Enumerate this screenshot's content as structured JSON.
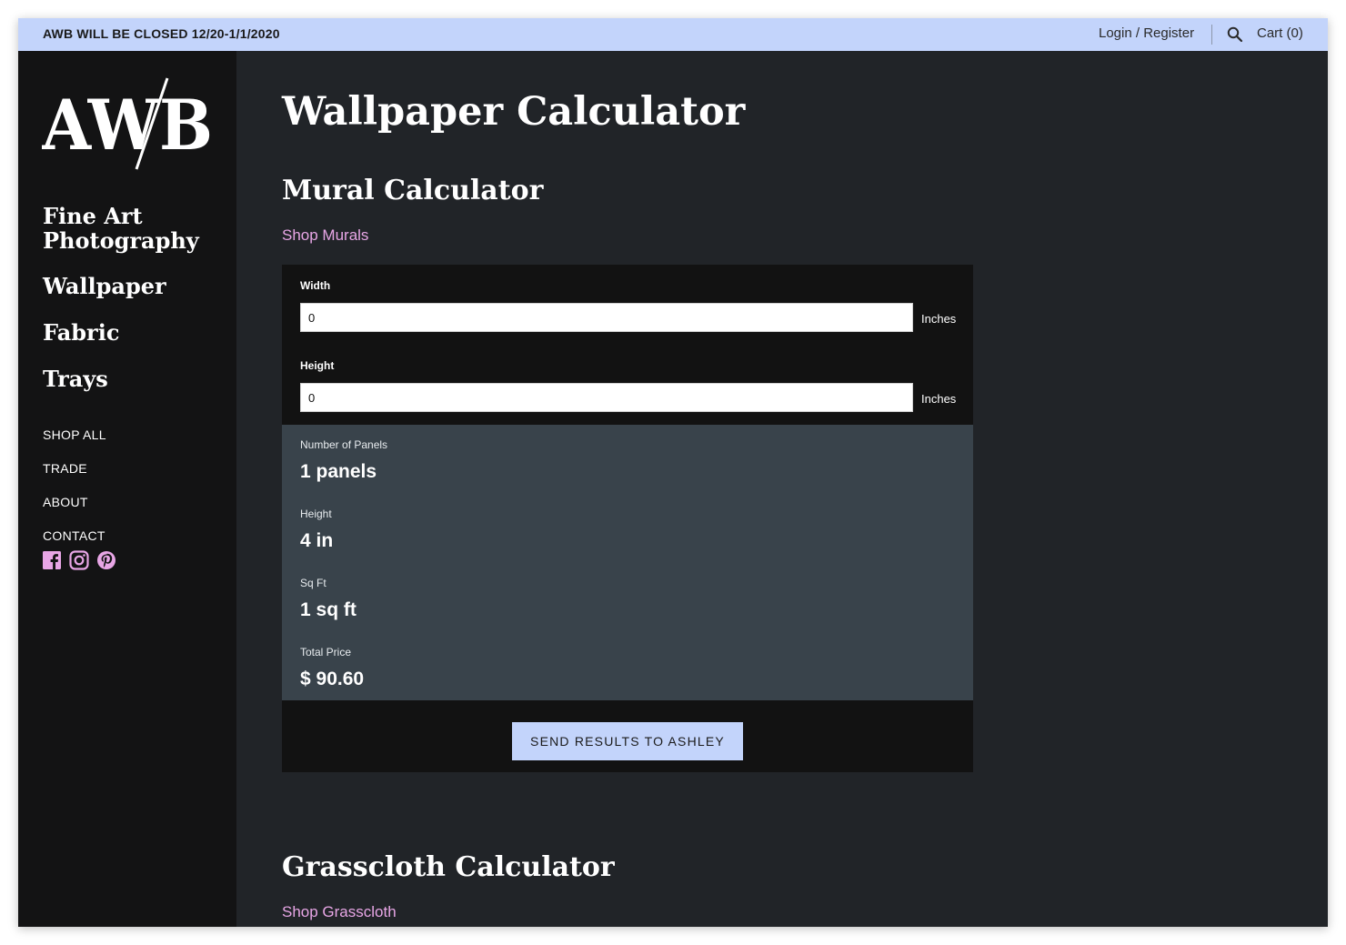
{
  "topbar": {
    "notice": "AWB WILL BE CLOSED 12/20-1/1/2020",
    "login": "Login / Register",
    "search_icon": "search-icon",
    "cart": "Cart (0)"
  },
  "sidebar": {
    "logo_text": "AWB",
    "nav_primary": [
      "Fine Art",
      "Photography",
      "Wallpaper",
      "Fabric",
      "Trays"
    ],
    "nav_secondary": [
      "SHOP ALL",
      "TRADE",
      "ABOUT",
      "CONTACT"
    ],
    "social": [
      "facebook-icon",
      "instagram-icon",
      "pinterest-icon"
    ],
    "social_color": "#e8a6e6"
  },
  "main": {
    "title": "Wallpaper Calculator",
    "mural": {
      "title": "Mural Calculator",
      "shop_link": "Shop Murals",
      "width_label": "Width",
      "width_value": "0",
      "height_label": "Height",
      "height_value": "0",
      "unit": "Inches",
      "results": {
        "panels_label": "Number of Panels",
        "panels_value": "1 panels",
        "height_label": "Height",
        "height_value": "4 in",
        "sqft_label": "Sq Ft",
        "sqft_value": "1 sq ft",
        "price_label": "Total Price",
        "price_value": "$ 90.60"
      },
      "send_button": "SEND RESULTS TO ASHLEY"
    },
    "grasscloth": {
      "title": "Grasscloth Calculator",
      "shop_link": "Shop Grasscloth"
    }
  },
  "colors": {
    "accent": "#c3d4fb",
    "link": "#e8a6e6",
    "sidebar_bg": "#131314",
    "main_bg": "#212428",
    "results_bg": "#39434b"
  }
}
